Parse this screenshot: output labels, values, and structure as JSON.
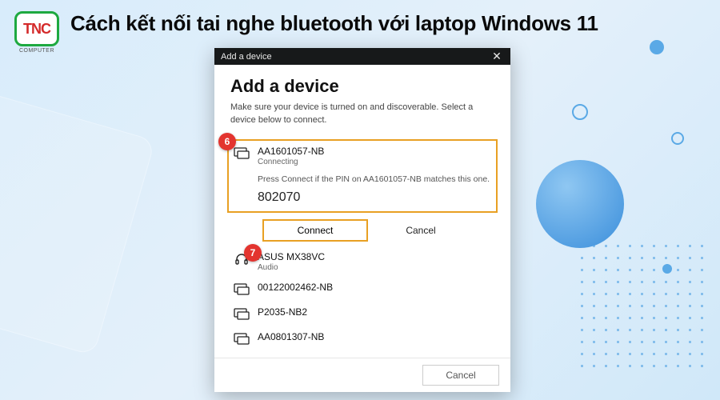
{
  "logo": {
    "brand": "TNC",
    "tag": "COMPUTER"
  },
  "page_title": "Cách kết nối tai nghe bluetooth với laptop Windows 11",
  "dialog": {
    "window_title": "Add a device",
    "heading": "Add a device",
    "subtext": "Make sure your device is turned on and discoverable. Select a device below to connect.",
    "badge6": "6",
    "badge7": "7",
    "connecting_device": {
      "name": "AA1601057-NB",
      "status": "Connecting",
      "pin_hint": "Press Connect if the PIN on AA1601057-NB matches this one.",
      "pin": "802070"
    },
    "connect_label": "Connect",
    "cancel_inner_label": "Cancel",
    "devices": [
      {
        "name": "ASUS MX38VC",
        "sub": "Audio",
        "icon": "headphones"
      },
      {
        "name": "00122002462-NB",
        "sub": "",
        "icon": "display"
      },
      {
        "name": "P2035-NB2",
        "sub": "",
        "icon": "display"
      },
      {
        "name": "AA0801307-NB",
        "sub": "",
        "icon": "display"
      }
    ],
    "footer_cancel": "Cancel"
  }
}
